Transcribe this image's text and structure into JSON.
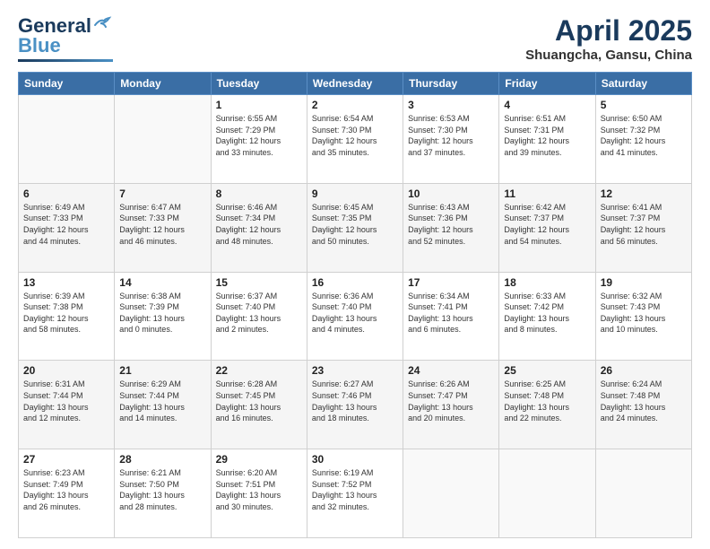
{
  "header": {
    "logo_general": "General",
    "logo_blue": "Blue",
    "month": "April 2025",
    "location": "Shuangcha, Gansu, China"
  },
  "weekdays": [
    "Sunday",
    "Monday",
    "Tuesday",
    "Wednesday",
    "Thursday",
    "Friday",
    "Saturday"
  ],
  "weeks": [
    [
      {
        "day": "",
        "info": ""
      },
      {
        "day": "",
        "info": ""
      },
      {
        "day": "1",
        "info": "Sunrise: 6:55 AM\nSunset: 7:29 PM\nDaylight: 12 hours\nand 33 minutes."
      },
      {
        "day": "2",
        "info": "Sunrise: 6:54 AM\nSunset: 7:30 PM\nDaylight: 12 hours\nand 35 minutes."
      },
      {
        "day": "3",
        "info": "Sunrise: 6:53 AM\nSunset: 7:30 PM\nDaylight: 12 hours\nand 37 minutes."
      },
      {
        "day": "4",
        "info": "Sunrise: 6:51 AM\nSunset: 7:31 PM\nDaylight: 12 hours\nand 39 minutes."
      },
      {
        "day": "5",
        "info": "Sunrise: 6:50 AM\nSunset: 7:32 PM\nDaylight: 12 hours\nand 41 minutes."
      }
    ],
    [
      {
        "day": "6",
        "info": "Sunrise: 6:49 AM\nSunset: 7:33 PM\nDaylight: 12 hours\nand 44 minutes."
      },
      {
        "day": "7",
        "info": "Sunrise: 6:47 AM\nSunset: 7:33 PM\nDaylight: 12 hours\nand 46 minutes."
      },
      {
        "day": "8",
        "info": "Sunrise: 6:46 AM\nSunset: 7:34 PM\nDaylight: 12 hours\nand 48 minutes."
      },
      {
        "day": "9",
        "info": "Sunrise: 6:45 AM\nSunset: 7:35 PM\nDaylight: 12 hours\nand 50 minutes."
      },
      {
        "day": "10",
        "info": "Sunrise: 6:43 AM\nSunset: 7:36 PM\nDaylight: 12 hours\nand 52 minutes."
      },
      {
        "day": "11",
        "info": "Sunrise: 6:42 AM\nSunset: 7:37 PM\nDaylight: 12 hours\nand 54 minutes."
      },
      {
        "day": "12",
        "info": "Sunrise: 6:41 AM\nSunset: 7:37 PM\nDaylight: 12 hours\nand 56 minutes."
      }
    ],
    [
      {
        "day": "13",
        "info": "Sunrise: 6:39 AM\nSunset: 7:38 PM\nDaylight: 12 hours\nand 58 minutes."
      },
      {
        "day": "14",
        "info": "Sunrise: 6:38 AM\nSunset: 7:39 PM\nDaylight: 13 hours\nand 0 minutes."
      },
      {
        "day": "15",
        "info": "Sunrise: 6:37 AM\nSunset: 7:40 PM\nDaylight: 13 hours\nand 2 minutes."
      },
      {
        "day": "16",
        "info": "Sunrise: 6:36 AM\nSunset: 7:40 PM\nDaylight: 13 hours\nand 4 minutes."
      },
      {
        "day": "17",
        "info": "Sunrise: 6:34 AM\nSunset: 7:41 PM\nDaylight: 13 hours\nand 6 minutes."
      },
      {
        "day": "18",
        "info": "Sunrise: 6:33 AM\nSunset: 7:42 PM\nDaylight: 13 hours\nand 8 minutes."
      },
      {
        "day": "19",
        "info": "Sunrise: 6:32 AM\nSunset: 7:43 PM\nDaylight: 13 hours\nand 10 minutes."
      }
    ],
    [
      {
        "day": "20",
        "info": "Sunrise: 6:31 AM\nSunset: 7:44 PM\nDaylight: 13 hours\nand 12 minutes."
      },
      {
        "day": "21",
        "info": "Sunrise: 6:29 AM\nSunset: 7:44 PM\nDaylight: 13 hours\nand 14 minutes."
      },
      {
        "day": "22",
        "info": "Sunrise: 6:28 AM\nSunset: 7:45 PM\nDaylight: 13 hours\nand 16 minutes."
      },
      {
        "day": "23",
        "info": "Sunrise: 6:27 AM\nSunset: 7:46 PM\nDaylight: 13 hours\nand 18 minutes."
      },
      {
        "day": "24",
        "info": "Sunrise: 6:26 AM\nSunset: 7:47 PM\nDaylight: 13 hours\nand 20 minutes."
      },
      {
        "day": "25",
        "info": "Sunrise: 6:25 AM\nSunset: 7:48 PM\nDaylight: 13 hours\nand 22 minutes."
      },
      {
        "day": "26",
        "info": "Sunrise: 6:24 AM\nSunset: 7:48 PM\nDaylight: 13 hours\nand 24 minutes."
      }
    ],
    [
      {
        "day": "27",
        "info": "Sunrise: 6:23 AM\nSunset: 7:49 PM\nDaylight: 13 hours\nand 26 minutes."
      },
      {
        "day": "28",
        "info": "Sunrise: 6:21 AM\nSunset: 7:50 PM\nDaylight: 13 hours\nand 28 minutes."
      },
      {
        "day": "29",
        "info": "Sunrise: 6:20 AM\nSunset: 7:51 PM\nDaylight: 13 hours\nand 30 minutes."
      },
      {
        "day": "30",
        "info": "Sunrise: 6:19 AM\nSunset: 7:52 PM\nDaylight: 13 hours\nand 32 minutes."
      },
      {
        "day": "",
        "info": ""
      },
      {
        "day": "",
        "info": ""
      },
      {
        "day": "",
        "info": ""
      }
    ]
  ]
}
